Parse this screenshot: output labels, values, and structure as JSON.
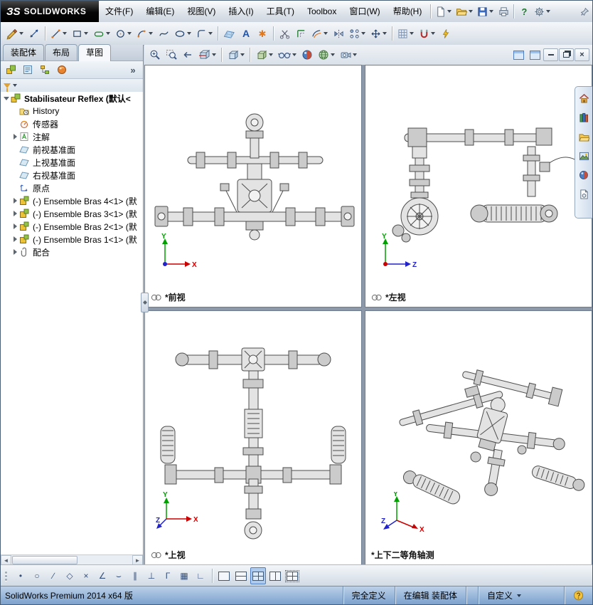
{
  "app": {
    "logo_prefix": "ЗS",
    "logo_text": "SOLIDWORKS"
  },
  "menu": {
    "items": [
      "文件(F)",
      "编辑(E)",
      "视图(V)",
      "插入(I)",
      "工具(T)",
      "Toolbox",
      "窗口(W)",
      "帮助(H)"
    ]
  },
  "icons": {
    "help": "?",
    "close": "×",
    "text_tool": "A",
    "point_tool": "✱",
    "panel_overflow": "»",
    "scroll_left": "◄",
    "scroll_right": "►"
  },
  "command_tabs": {
    "items": [
      "装配体",
      "布局",
      "草图"
    ],
    "active_index": 2
  },
  "tree": {
    "root_label": "Stabilisateur Reflex  (默认<",
    "items": [
      {
        "icon": "history",
        "label": "History",
        "expand": false
      },
      {
        "icon": "sensors",
        "label": "传感器",
        "expand": false
      },
      {
        "icon": "annotations",
        "label": "注解",
        "expand": true
      },
      {
        "icon": "plane",
        "label": "前视基准面",
        "expand": false
      },
      {
        "icon": "plane",
        "label": "上视基准面",
        "expand": false
      },
      {
        "icon": "plane",
        "label": "右视基准面",
        "expand": false
      },
      {
        "icon": "origin",
        "label": "原点",
        "expand": false
      },
      {
        "icon": "component",
        "label": "(-) Ensemble Bras 4<1> (默",
        "expand": true
      },
      {
        "icon": "component",
        "label": "(-) Ensemble Bras 3<1> (默",
        "expand": true
      },
      {
        "icon": "component",
        "label": "(-) Ensemble Bras 2<1> (默",
        "expand": true
      },
      {
        "icon": "component",
        "label": "(-) Ensemble Bras 1<1> (默",
        "expand": true
      },
      {
        "icon": "mates",
        "label": "配合",
        "expand": true
      }
    ]
  },
  "viewports": [
    {
      "label": "*前视"
    },
    {
      "label": "*左视"
    },
    {
      "label": "*上视"
    },
    {
      "label": "*上下二等角轴测"
    }
  ],
  "axes": {
    "x": "X",
    "y": "Y",
    "z": "Z"
  },
  "bottom_toolbar": {
    "snaps": [
      {
        "name": "snap-points",
        "glyph": "•"
      },
      {
        "name": "snap-center-points",
        "glyph": "○"
      },
      {
        "name": "snap-midpoints",
        "glyph": "∕"
      },
      {
        "name": "snap-quadrants",
        "glyph": "◇"
      },
      {
        "name": "snap-intersections",
        "glyph": "×"
      },
      {
        "name": "snap-angle",
        "glyph": "∠"
      },
      {
        "name": "snap-tangent",
        "glyph": "⌣"
      },
      {
        "name": "snap-parallel",
        "glyph": "∥"
      },
      {
        "name": "snap-perpendicular",
        "glyph": "⊥"
      },
      {
        "name": "snap-hv-lines",
        "glyph": "Γ"
      },
      {
        "name": "snap-grid",
        "glyph": "▦"
      },
      {
        "name": "snap-ortho",
        "glyph": "∟"
      }
    ],
    "layouts": [
      {
        "name": "viewport-layout-single",
        "active": false
      },
      {
        "name": "viewport-layout-two-horizontal",
        "active": false
      },
      {
        "name": "viewport-layout-four",
        "active": true
      },
      {
        "name": "viewport-layout-two-vertical",
        "active": false
      },
      {
        "name": "viewport-layout-link",
        "active": false
      }
    ]
  },
  "statusbar": {
    "product": "SolidWorks Premium 2014 x64 版",
    "define_state": "完全定义",
    "edit_state": "在编辑 装配体",
    "custom": "自定义"
  }
}
